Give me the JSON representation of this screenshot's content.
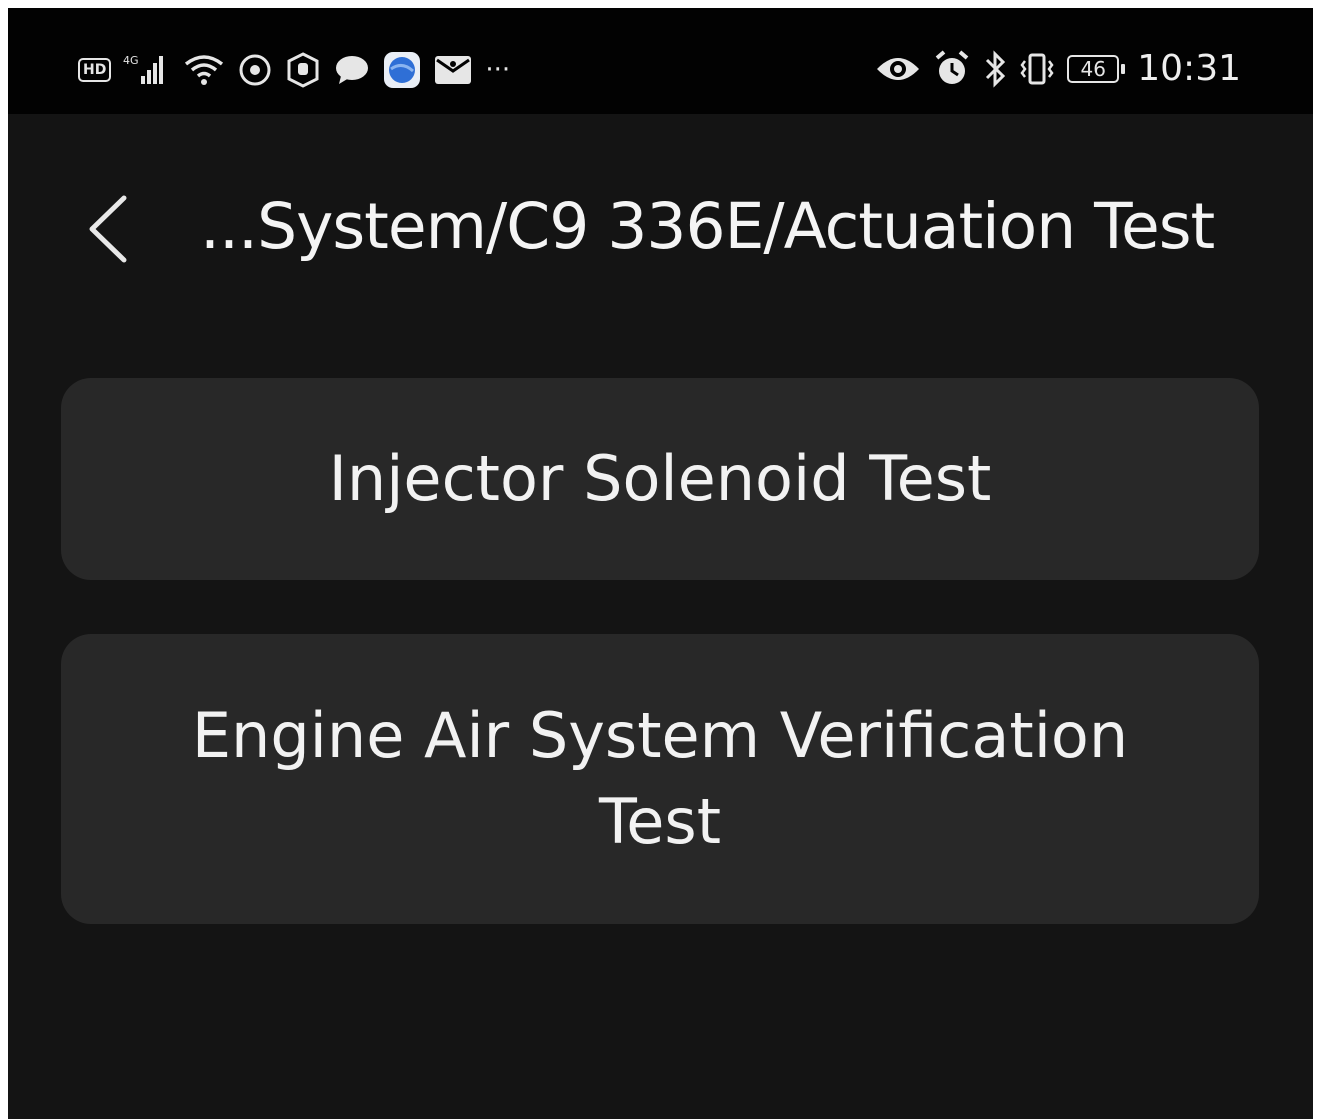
{
  "status_bar": {
    "hd_label": "HD",
    "network_label": "4G",
    "battery_level": "46",
    "time": "10:31",
    "more_label": "···",
    "left_icons": [
      "hd-icon",
      "signal-icon",
      "wifi-icon",
      "vpn-icon",
      "shield-icon",
      "chat-icon",
      "browser-icon",
      "mail-icon",
      "more-icon"
    ],
    "right_icons": [
      "eye-icon",
      "alarm-icon",
      "bluetooth-icon",
      "vibrate-icon",
      "battery-icon"
    ]
  },
  "header": {
    "title": "...System/C9 336E/Actuation Test",
    "back_icon": "chevron-left-icon"
  },
  "options": [
    {
      "label": "Injector Solenoid Test"
    },
    {
      "label": "Engine Air System Verification Test"
    }
  ],
  "colors": {
    "background": "#141414",
    "status_bar": "#020202",
    "card": "#282828",
    "text": "#f2f2f2"
  }
}
